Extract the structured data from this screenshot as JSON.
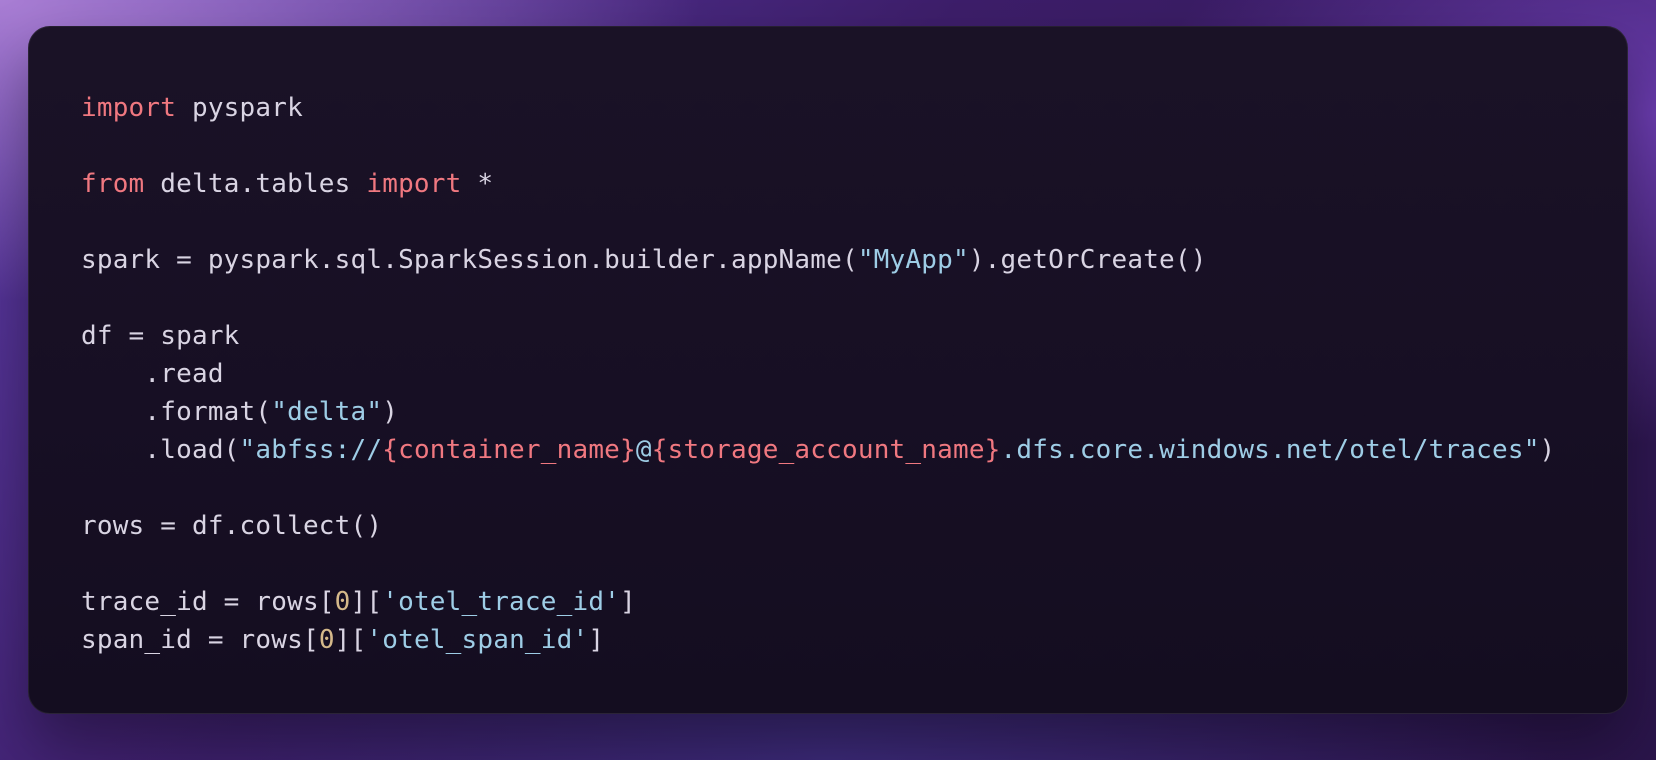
{
  "syntax_colors": {
    "keyword": "#f07880",
    "string": "#9ecde6",
    "number": "#d5b98a",
    "format_spec": "#f07880",
    "plain": "#d9d4e3"
  },
  "code": {
    "lines": [
      [
        {
          "cls": "kw",
          "t": "import"
        },
        {
          "cls": "plain",
          "t": " pyspark"
        }
      ],
      [],
      [
        {
          "cls": "kw",
          "t": "from"
        },
        {
          "cls": "plain",
          "t": " delta.tables "
        },
        {
          "cls": "kw",
          "t": "import"
        },
        {
          "cls": "plain",
          "t": " *"
        }
      ],
      [],
      [
        {
          "cls": "plain",
          "t": "spark = pyspark.sql.SparkSession.builder.appName("
        },
        {
          "cls": "str",
          "t": "\"MyApp\""
        },
        {
          "cls": "plain",
          "t": ").getOrCreate()"
        }
      ],
      [],
      [
        {
          "cls": "plain",
          "t": "df = spark"
        }
      ],
      [
        {
          "cls": "plain",
          "t": "    .read"
        }
      ],
      [
        {
          "cls": "plain",
          "t": "    .format("
        },
        {
          "cls": "str",
          "t": "\"delta\""
        },
        {
          "cls": "plain",
          "t": ")"
        }
      ],
      [
        {
          "cls": "plain",
          "t": "    .load("
        },
        {
          "cls": "str",
          "t": "\"abfss://"
        },
        {
          "cls": "fmt",
          "t": "{container_name}"
        },
        {
          "cls": "str",
          "t": "@"
        },
        {
          "cls": "fmt",
          "t": "{storage_account_name}"
        },
        {
          "cls": "str",
          "t": ".dfs.core.windows.net/otel/traces\""
        },
        {
          "cls": "plain",
          "t": ")"
        }
      ],
      [],
      [
        {
          "cls": "plain",
          "t": "rows = df.collect()"
        }
      ],
      [],
      [
        {
          "cls": "plain",
          "t": "trace_id = rows["
        },
        {
          "cls": "num",
          "t": "0"
        },
        {
          "cls": "plain",
          "t": "]["
        },
        {
          "cls": "str",
          "t": "'otel_trace_id'"
        },
        {
          "cls": "plain",
          "t": "]"
        }
      ],
      [
        {
          "cls": "plain",
          "t": "span_id = rows["
        },
        {
          "cls": "num",
          "t": "0"
        },
        {
          "cls": "plain",
          "t": "]["
        },
        {
          "cls": "str",
          "t": "'otel_span_id'"
        },
        {
          "cls": "plain",
          "t": "]"
        }
      ]
    ]
  }
}
